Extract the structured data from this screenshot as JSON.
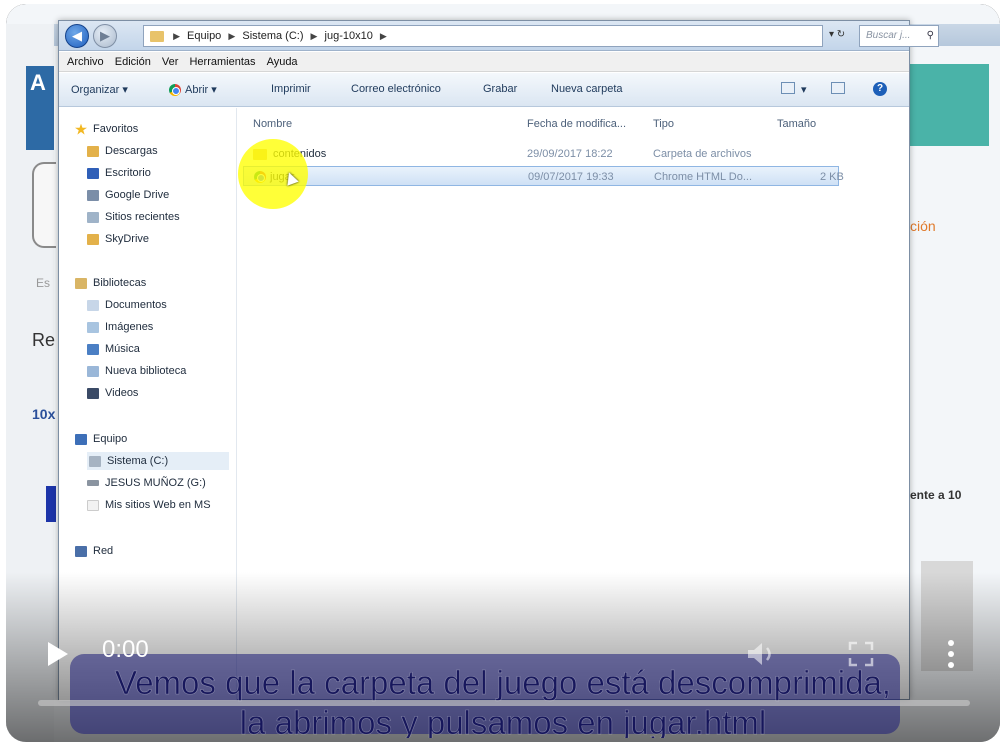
{
  "explorer": {
    "breadcrumb": [
      "Equipo",
      "Sistema (C:)",
      "jug-10x10"
    ],
    "search_placeholder": "Buscar j...",
    "menu": [
      "Archivo",
      "Edición",
      "Ver",
      "Herramientas",
      "Ayuda"
    ],
    "toolbar": {
      "organize": "Organizar ▾",
      "open": "Abrir ▾",
      "print": "Imprimir",
      "email": "Correo electrónico",
      "burn": "Grabar",
      "new_folder": "Nueva carpeta"
    },
    "nav": {
      "favorites": "Favoritos",
      "downloads": "Descargas",
      "desktop": "Escritorio",
      "google_drive": "Google Drive",
      "recent": "Sitios recientes",
      "skydrive": "SkyDrive",
      "libraries": "Bibliotecas",
      "documents": "Documentos",
      "images": "Imágenes",
      "music": "Música",
      "new_library": "Nueva biblioteca",
      "videos": "Videos",
      "computer": "Equipo",
      "system_c": "Sistema (C:)",
      "drive_g": "JESUS MUÑOZ (G:)",
      "my_sites": "Mis sitios Web en MS",
      "network": "Red"
    },
    "columns": {
      "name": "Nombre",
      "modified": "Fecha de modifica...",
      "type": "Tipo",
      "size": "Tamaño"
    },
    "files": [
      {
        "name": "contenidos",
        "modified": "29/09/2017 18:22",
        "type": "Carpeta de archivos",
        "size": ""
      },
      {
        "name": "jugar",
        "modified": "09/07/2017 19:33",
        "type": "Chrome HTML Do...",
        "size": "2 KB"
      }
    ]
  },
  "background_page": {
    "frag_a": "A",
    "frag_es": "Es",
    "frag_re": "Re",
    "frag_10x": "10x",
    "frag_cion": "ción",
    "frag_ente": "ente a 10"
  },
  "video": {
    "time": "0:00",
    "subtitle_line1": "Vemos que la carpeta del juego está descomprimida,",
    "subtitle_line2": "la abrimos y pulsamos en jugar.html"
  },
  "colors": {
    "highlight": "#ffff00",
    "accent_teal": "#4ab3a8",
    "selection": "#cfe1f5"
  }
}
